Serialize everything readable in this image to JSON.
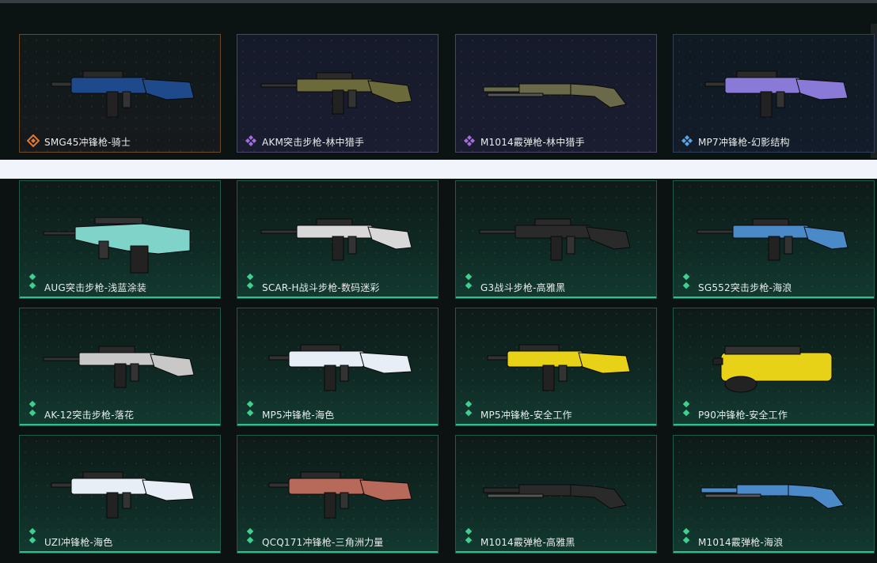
{
  "colors": {
    "orange_rarity": "#e07a2e",
    "purple_rarity": "#a46ee0",
    "blue_rarity": "#5aa6e8",
    "green_rarity": "#3fcf8e"
  },
  "cards": [
    {
      "label": "SMG45冲锋枪-骑士",
      "rarity": "orange",
      "icon": "diamond-orange-icon",
      "weapon": "smg-icon",
      "accent": "#1e4a8c"
    },
    {
      "label": "AKM突击步枪-林中猎手",
      "rarity": "purple",
      "icon": "diamond-purple-icon",
      "weapon": "rifle-icon",
      "accent": "#6a6a3a"
    },
    {
      "label": "M1014霰弹枪-林中猎手",
      "rarity": "purple",
      "icon": "diamond-purple-icon",
      "weapon": "shotgun-icon",
      "accent": "#6a6a4a"
    },
    {
      "label": "MP7冲锋枪-幻影结构",
      "rarity": "blue",
      "icon": "diamond-blue-icon",
      "weapon": "smg-icon",
      "accent": "#8a7ad8"
    },
    {
      "label": "AUG突击步枪-浅蓝涂装",
      "rarity": "green",
      "icon": "double-diamond-green-icon",
      "weapon": "bullpup-icon",
      "accent": "#7fd3c8"
    },
    {
      "label": "SCAR-H战斗步枪-数码迷彩",
      "rarity": "green",
      "icon": "double-diamond-green-icon",
      "weapon": "rifle-icon",
      "accent": "#d8d8d8"
    },
    {
      "label": "G3战斗步枪-高雅黑",
      "rarity": "green",
      "icon": "double-diamond-green-icon",
      "weapon": "rifle-icon",
      "accent": "#2a2a2a"
    },
    {
      "label": "SG552突击步枪-海浪",
      "rarity": "green",
      "icon": "double-diamond-green-icon",
      "weapon": "rifle-icon",
      "accent": "#4a8ac8"
    },
    {
      "label": "AK-12突击步枪-落花",
      "rarity": "green",
      "icon": "double-diamond-green-icon",
      "weapon": "rifle-icon",
      "accent": "#c8c8c8"
    },
    {
      "label": "MP5冲锋枪-海色",
      "rarity": "green",
      "icon": "double-diamond-green-icon",
      "weapon": "smg-icon",
      "accent": "#e8eef6"
    },
    {
      "label": "MP5冲锋枪-安全工作",
      "rarity": "green",
      "icon": "double-diamond-green-icon",
      "weapon": "smg-icon",
      "accent": "#e8d218"
    },
    {
      "label": "P90冲锋枪-安全工作",
      "rarity": "green",
      "icon": "double-diamond-green-icon",
      "weapon": "p90-icon",
      "accent": "#e8d218"
    },
    {
      "label": "UZI冲锋枪-海色",
      "rarity": "green",
      "icon": "double-diamond-green-icon",
      "weapon": "smg-icon",
      "accent": "#e8eef6"
    },
    {
      "label": "QCQ171冲锋枪-三角洲力量",
      "rarity": "green",
      "icon": "double-diamond-green-icon",
      "weapon": "smg-icon",
      "accent": "#b86a5a"
    },
    {
      "label": "M1014霰弹枪-高雅黑",
      "rarity": "green",
      "icon": "double-diamond-green-icon",
      "weapon": "shotgun-icon",
      "accent": "#2a2a2a"
    },
    {
      "label": "M1014霰弹枪-海浪",
      "rarity": "green",
      "icon": "double-diamond-green-icon",
      "weapon": "shotgun-icon",
      "accent": "#4a8ac8"
    }
  ]
}
